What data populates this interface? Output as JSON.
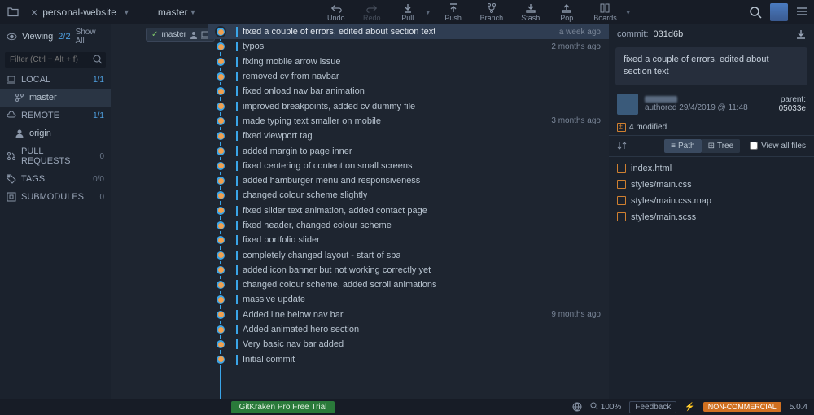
{
  "header": {
    "repo": "personal-website",
    "branch": "master"
  },
  "toolbar": {
    "undo": "Undo",
    "redo": "Redo",
    "pull": "Pull",
    "push": "Push",
    "branch": "Branch",
    "stash": "Stash",
    "pop": "Pop",
    "boards": "Boards"
  },
  "sidebar": {
    "viewing": "Viewing",
    "viewing_count": "2/2",
    "showall": "Show All",
    "filter_placeholder": "Filter (Ctrl + Alt + f)",
    "sections": {
      "local": {
        "label": "LOCAL",
        "badge": "1/1",
        "items": [
          {
            "name": "master"
          }
        ]
      },
      "remote": {
        "label": "REMOTE",
        "badge": "1/1",
        "items": [
          {
            "name": "origin"
          }
        ]
      },
      "pull": {
        "label": "PULL REQUESTS",
        "badge": "0"
      },
      "tags": {
        "label": "TAGS",
        "badge": "0/0"
      },
      "submodules": {
        "label": "SUBMODULES",
        "badge": "0"
      }
    }
  },
  "branch_label": "master",
  "commits": [
    {
      "msg": "fixed a couple of errors, edited about section text",
      "time": "a week ago",
      "selected": true
    },
    {
      "msg": "typos",
      "time": "2 months ago"
    },
    {
      "msg": "fixing mobile arrow issue"
    },
    {
      "msg": "removed cv from navbar"
    },
    {
      "msg": "fixed onload nav bar animation"
    },
    {
      "msg": "improved breakpoints, added cv dummy file"
    },
    {
      "msg": "made typing text smaller on mobile",
      "time": "3 months ago"
    },
    {
      "msg": "fixed viewport tag"
    },
    {
      "msg": "added margin to page inner"
    },
    {
      "msg": "fixed centering of content on small screens"
    },
    {
      "msg": "added hamburger menu and responsiveness"
    },
    {
      "msg": "changed colour scheme slightly"
    },
    {
      "msg": "fixed slider text animation, added contact page"
    },
    {
      "msg": "fixed header, changed colour scheme"
    },
    {
      "msg": "fixed portfolio slider"
    },
    {
      "msg": "completely changed layout - start of spa"
    },
    {
      "msg": "added icon banner but not working correctly yet"
    },
    {
      "msg": "changed colour scheme, added scroll animations"
    },
    {
      "msg": "massive update"
    },
    {
      "msg": "Added line below nav bar",
      "time": "9 months ago"
    },
    {
      "msg": "Added animated hero section"
    },
    {
      "msg": "Very basic nav bar added"
    },
    {
      "msg": "Initial commit"
    }
  ],
  "detail": {
    "commit_label": "commit:",
    "sha": "031d6b",
    "title": "fixed a couple of errors, edited about section text",
    "authored_prefix": "authored",
    "authored_date": "29/4/2019 @ 11:48",
    "parent_label": "parent:",
    "parent_sha": "05033e",
    "modified": "4 modified",
    "path_btn": "Path",
    "tree_btn": "Tree",
    "view_all": "View all files",
    "files": [
      "index.html",
      "styles/main.css",
      "styles/main.css.map",
      "styles/main.scss"
    ]
  },
  "status": {
    "trial": "GitKraken Pro Free Trial",
    "zoom": "100%",
    "feedback": "Feedback",
    "license": "NON-COMMERCIAL",
    "version": "5.0.4"
  }
}
